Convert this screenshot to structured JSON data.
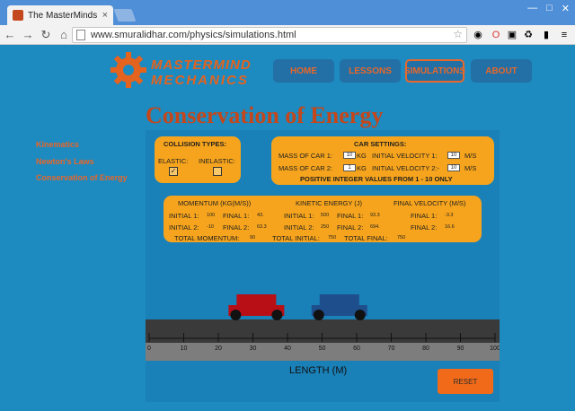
{
  "browser": {
    "tab_title": "The MasterMinds Physics",
    "tab_close": "×",
    "url": "www.smuralidhar.com/physics/simulations.html"
  },
  "logo": {
    "line1": "MASTERMIND",
    "line2": "MECHANICS"
  },
  "nav": [
    {
      "label": "HOME"
    },
    {
      "label": "LESSONS"
    },
    {
      "label": "SIMULATIONS"
    },
    {
      "label": "ABOUT"
    }
  ],
  "page_title": "Conservation of Energy",
  "sidebar": [
    {
      "label": "Kinematics"
    },
    {
      "label": "Newton's Laws"
    },
    {
      "label": "Conservation of Energy"
    }
  ],
  "collision": {
    "title": "COLLISION TYPES:",
    "elastic_label": "ELASTIC:",
    "inelastic_label": "INELASTIC:",
    "elastic_checked": true,
    "inelastic_checked": false
  },
  "car_settings": {
    "title": "CAR SETTINGS:",
    "mass1_label": "MASS OF CAR 1:",
    "mass1_value": "10",
    "mass2_label": "MASS OF CAR 2:",
    "mass2_value": "1",
    "kg": "KG",
    "vel1_label": "INITIAL VELOCITY 1:",
    "vel1_value": "10",
    "vel2_label": "INITIAL VELOCITY 2:-",
    "vel2_value": "10",
    "ms": "M/S",
    "note": "POSITIVE INTEGER VALUES FROM 1 - 10 ONLY"
  },
  "results": {
    "momentum_title": "MOMENTUM (KG(M/S))",
    "ke_title": "KINETIC ENERGY (J)",
    "fv_title": "FINAL VELOCITY (M/S)",
    "initial1": "INITIAL 1:",
    "final1": "FINAL 1:",
    "initial2": "INITIAL 2:",
    "final2": "FINAL 2:",
    "mom_i1": "100",
    "mom_f1": "43.",
    "mom_i2": "-10",
    "mom_f2": "63.3",
    "ke_i1": "500",
    "ke_f1": "93.3",
    "ke_i2": "250",
    "ke_f2": "694.",
    "fv_f1": "-3.3",
    "fv_f2": "16.6",
    "total_momentum_label": "TOTAL MOMENTUM:",
    "total_momentum_value": "90",
    "total_initial_label": "TOTAL INITIAL:",
    "total_initial_value": "750",
    "total_final_label": "TOTAL FINAL:",
    "total_final_value": "750"
  },
  "track": {
    "ticks": [
      "0",
      "10",
      "20",
      "30",
      "40",
      "50",
      "60",
      "70",
      "80",
      "90",
      "100"
    ],
    "axis_label": "LENGTH (M)"
  },
  "cars": [
    {
      "color": "#b80f17",
      "position_m": 31
    },
    {
      "color": "#1f4e8c",
      "position_m": 55
    }
  ],
  "reset_label": "RESET",
  "colors": {
    "page_bg": "#1d8ac0",
    "accent": "#e8672a",
    "box": "#f6a41d"
  }
}
